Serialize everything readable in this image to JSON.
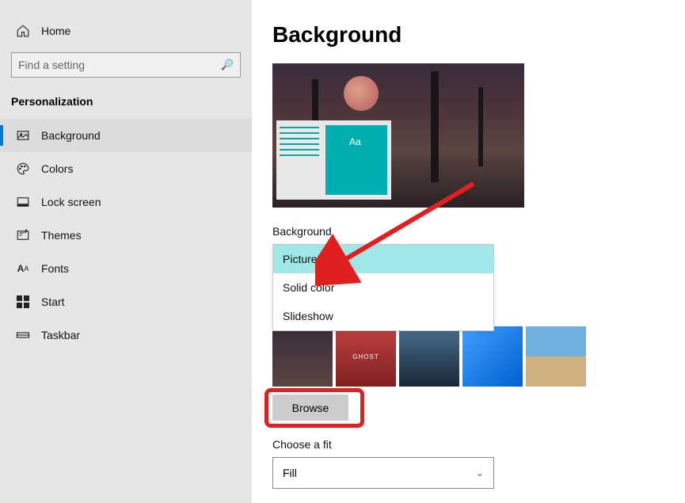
{
  "sidebar": {
    "home": "Home",
    "searchPlaceholder": "Find a setting",
    "section": "Personalization",
    "items": [
      {
        "label": "Background",
        "active": true
      },
      {
        "label": "Colors",
        "active": false
      },
      {
        "label": "Lock screen",
        "active": false
      },
      {
        "label": "Themes",
        "active": false
      },
      {
        "label": "Fonts",
        "active": false
      },
      {
        "label": "Start",
        "active": false
      },
      {
        "label": "Taskbar",
        "active": false
      }
    ]
  },
  "content": {
    "title": "Background",
    "previewSample": "Aa",
    "backgroundLabel": "Background",
    "backgroundOptions": [
      "Picture",
      "Solid color",
      "Slideshow"
    ],
    "backgroundSelected": "Picture",
    "browseLabel": "Browse",
    "fitLabel": "Choose a fit",
    "fitValue": "Fill"
  }
}
